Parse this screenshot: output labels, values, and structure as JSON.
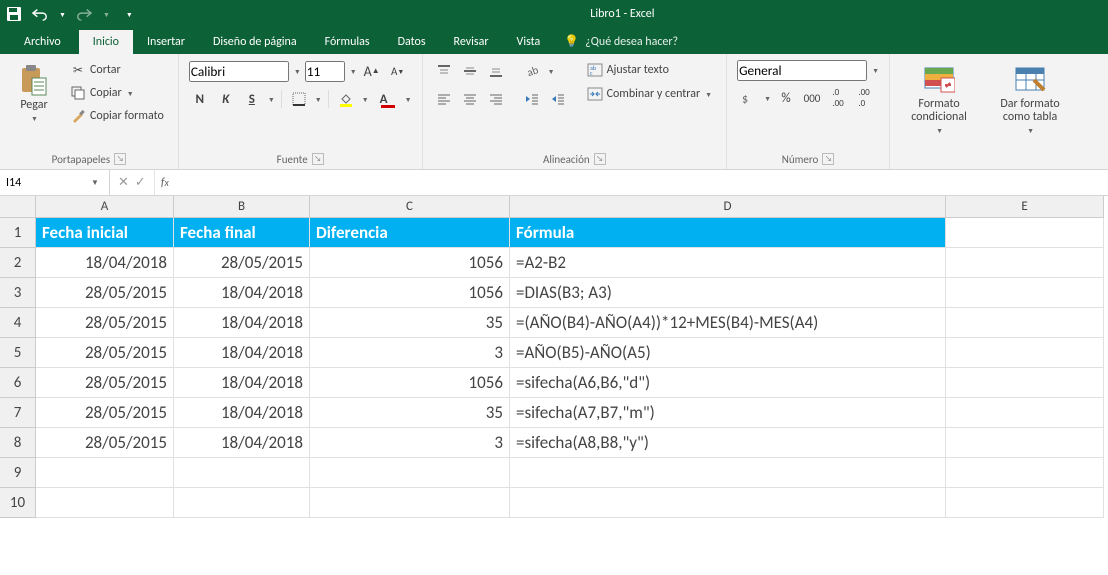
{
  "title": "Libro1 - Excel",
  "tabs": {
    "file": "Archivo",
    "items": [
      "Inicio",
      "Insertar",
      "Diseño de página",
      "Fórmulas",
      "Datos",
      "Revisar",
      "Vista"
    ],
    "active": 0,
    "tell_me_placeholder": "¿Qué desea hacer?"
  },
  "ribbon": {
    "clipboard": {
      "label": "Portapapeles",
      "paste": "Pegar",
      "cut": "Cortar",
      "copy": "Copiar",
      "format_painter": "Copiar formato"
    },
    "font": {
      "label": "Fuente",
      "name": "Calibri",
      "size": "11",
      "bold": "N",
      "italic": "K",
      "underline": "S"
    },
    "alignment": {
      "label": "Alineación",
      "wrap": "Ajustar texto",
      "merge": "Combinar y centrar"
    },
    "number": {
      "label": "Número",
      "format": "General"
    },
    "styles": {
      "cond": "Formato condicional",
      "table": "Dar formato como tabla"
    }
  },
  "name_box": "I14",
  "formula": "",
  "columns": [
    "A",
    "B",
    "C",
    "D",
    "E"
  ],
  "header_row": [
    "Fecha inicial",
    "Fecha final",
    "Diferencia",
    "Fórmula"
  ],
  "data_rows": [
    {
      "n": "2",
      "A": "18/04/2018",
      "B": "28/05/2015",
      "C": "1056",
      "D": "=A2-B2"
    },
    {
      "n": "3",
      "A": "28/05/2015",
      "B": "18/04/2018",
      "C": "1056",
      "D": "=DIAS(B3; A3)"
    },
    {
      "n": "4",
      "A": "28/05/2015",
      "B": "18/04/2018",
      "C": "35",
      "D": "=(AÑO(B4)-AÑO(A4))*12+MES(B4)-MES(A4)"
    },
    {
      "n": "5",
      "A": "28/05/2015",
      "B": "18/04/2018",
      "C": "3",
      "D": "=AÑO(B5)-AÑO(A5)"
    },
    {
      "n": "6",
      "A": "28/05/2015",
      "B": "18/04/2018",
      "C": "1056",
      "D": "=sifecha(A6,B6,\"d\")"
    },
    {
      "n": "7",
      "A": "28/05/2015",
      "B": "18/04/2018",
      "C": "35",
      "D": "=sifecha(A7,B7,\"m\")"
    },
    {
      "n": "8",
      "A": "28/05/2015",
      "B": "18/04/2018",
      "C": "3",
      "D": "=sifecha(A8,B8,\"y\")"
    }
  ],
  "empty_rows": [
    "9",
    "10"
  ],
  "chart_data": {
    "type": "table",
    "columns": [
      "Fecha inicial",
      "Fecha final",
      "Diferencia",
      "Fórmula"
    ],
    "rows": [
      [
        "18/04/2018",
        "28/05/2015",
        1056,
        "=A2-B2"
      ],
      [
        "28/05/2015",
        "18/04/2018",
        1056,
        "=DIAS(B3; A3)"
      ],
      [
        "28/05/2015",
        "18/04/2018",
        35,
        "=(AÑO(B4)-AÑO(A4))*12+MES(B4)-MES(A4)"
      ],
      [
        "28/05/2015",
        "18/04/2018",
        3,
        "=AÑO(B5)-AÑO(A5)"
      ],
      [
        "28/05/2015",
        "18/04/2018",
        1056,
        "=sifecha(A6,B6,\"d\")"
      ],
      [
        "28/05/2015",
        "18/04/2018",
        35,
        "=sifecha(A7,B7,\"m\")"
      ],
      [
        "28/05/2015",
        "18/04/2018",
        3,
        "=sifecha(A8,B8,\"y\")"
      ]
    ]
  }
}
